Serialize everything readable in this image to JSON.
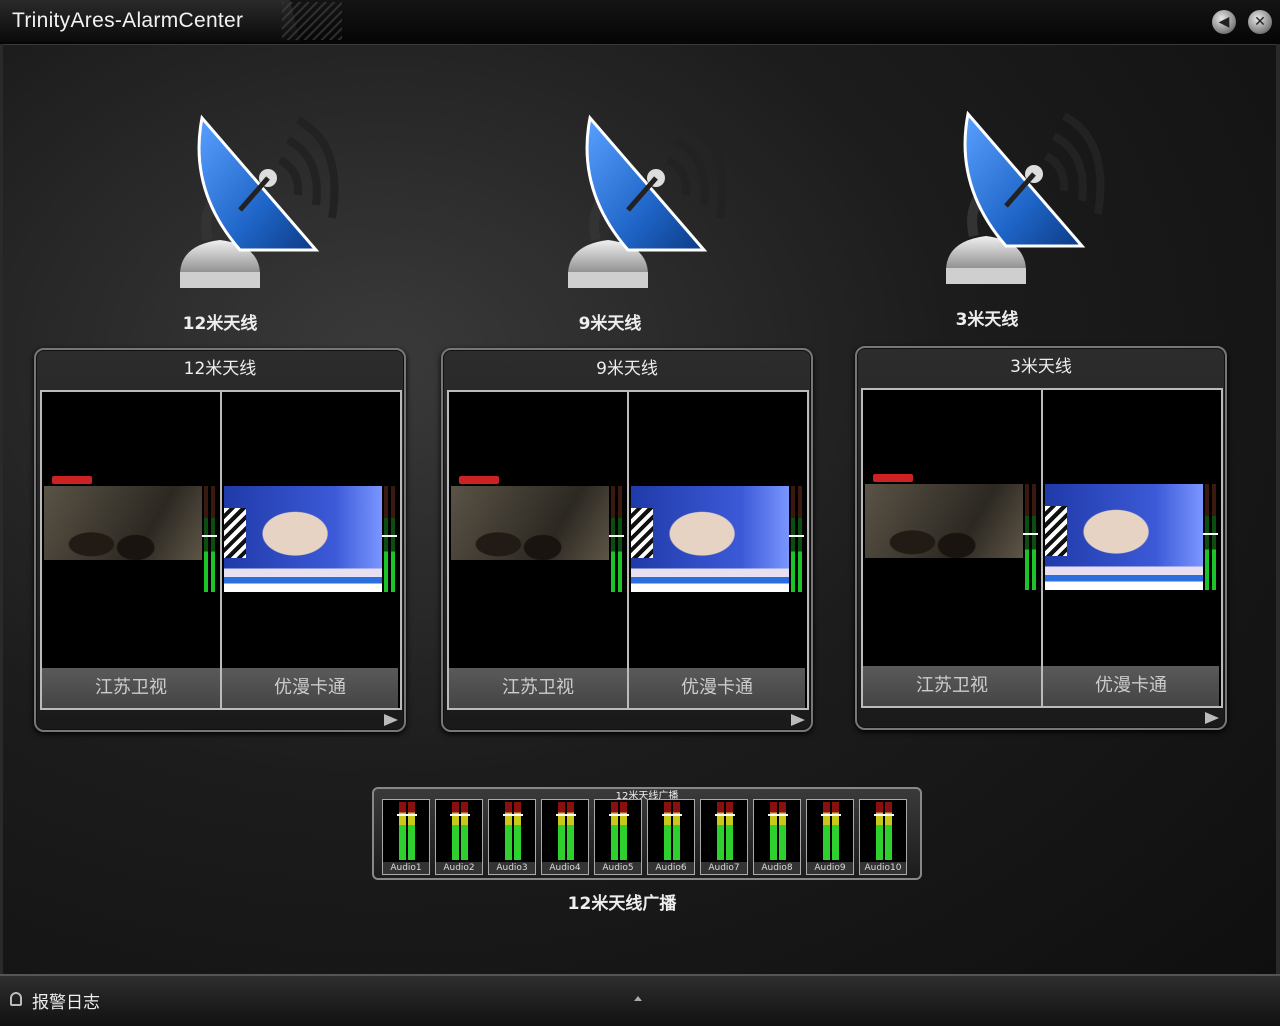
{
  "window": {
    "title": "TrinityAres-AlarmCenter"
  },
  "titlebar": {
    "sound_icon": "speaker-icon",
    "close_icon": "close-icon"
  },
  "antennas": [
    {
      "label": "12米天线"
    },
    {
      "label": "9米天线"
    },
    {
      "label": "3米天线"
    }
  ],
  "panels": [
    {
      "title": "12米天线",
      "channels": [
        {
          "name": "江苏卫视"
        },
        {
          "name": "优漫卡通"
        }
      ]
    },
    {
      "title": "9米天线",
      "channels": [
        {
          "name": "江苏卫视"
        },
        {
          "name": "优漫卡通"
        }
      ]
    },
    {
      "title": "3米天线",
      "channels": [
        {
          "name": "江苏卫视"
        },
        {
          "name": "优漫卡通"
        }
      ]
    }
  ],
  "audio": {
    "title": "12米天线广播",
    "label": "12米天线广播",
    "channels": [
      "Audio1",
      "Audio2",
      "Audio3",
      "Audio4",
      "Audio5",
      "Audio6",
      "Audio7",
      "Audio8",
      "Audio9",
      "Audio10"
    ]
  },
  "statusbar": {
    "log_label": "报警日志"
  },
  "colors": {
    "dish_blue": "#1f66c8",
    "meter_green": "#1cc42a",
    "background": "#1c1c1c"
  }
}
